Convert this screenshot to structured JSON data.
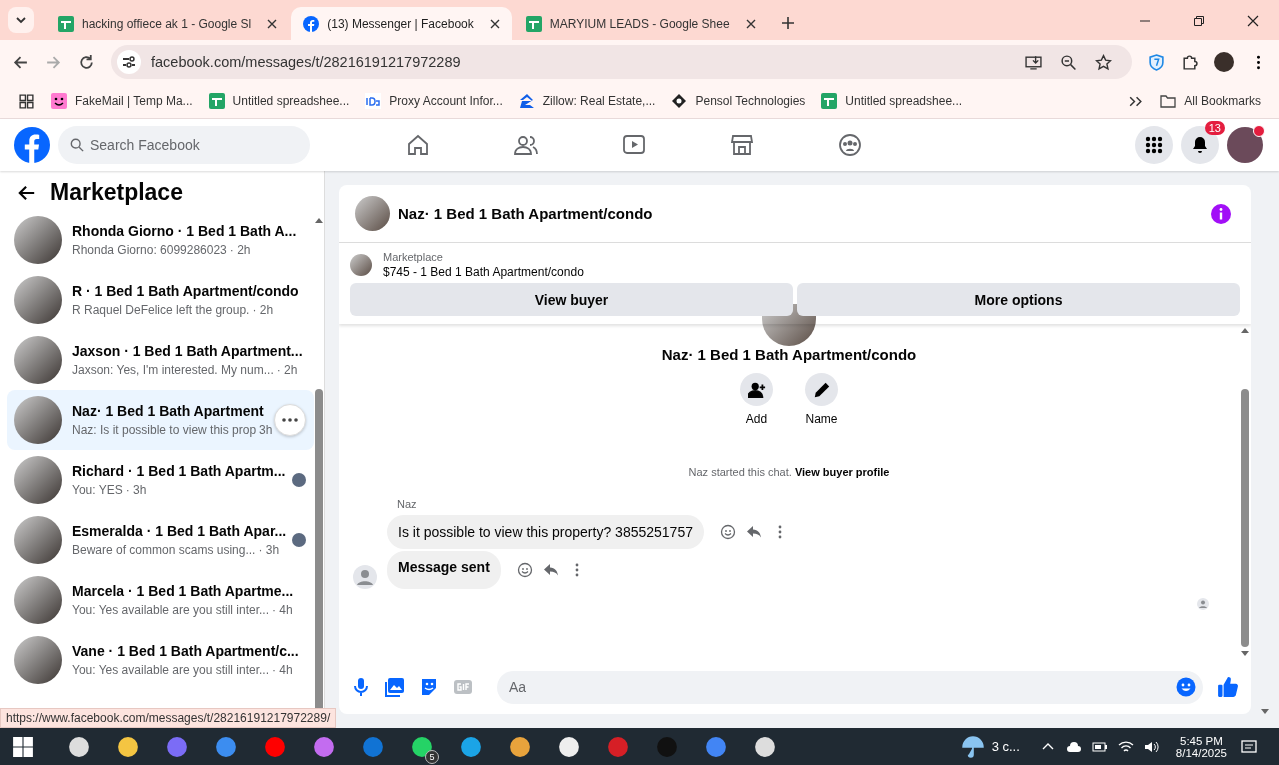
{
  "browser": {
    "tabs": [
      {
        "title": "hacking offiece ak 1 - Google Sl",
        "kind": "sheets",
        "selected": false
      },
      {
        "title": "(13) Messenger | Facebook",
        "kind": "facebook",
        "selected": true
      },
      {
        "title": "MARYIUM LEADS - Google Shee",
        "kind": "sheets",
        "selected": false
      }
    ],
    "url": "facebook.com/messages/t/28216191217972289",
    "bookmarks": [
      {
        "label": "FakeMail | Temp Ma...",
        "kind": "smiley"
      },
      {
        "label": "Untitled spreadshee...",
        "kind": "sheets"
      },
      {
        "label": "Proxy Account Infor...",
        "kind": "ip"
      },
      {
        "label": "Zillow: Real Estate,...",
        "kind": "zillow"
      },
      {
        "label": "Pensol Technologies",
        "kind": "pensol"
      },
      {
        "label": "Untitled spreadshee...",
        "kind": "sheets"
      }
    ],
    "all_bookmarks": "All Bookmarks"
  },
  "facebook": {
    "search": {
      "placeholder": "Search Facebook"
    },
    "notification_count": "13"
  },
  "sidebar": {
    "title": "Marketplace",
    "conversations": [
      {
        "title": "Rhonda Giorno · 1 Bed 1 Bath A...",
        "preview": "Rhonda Giorno: 6099286023",
        "time": "· 2h",
        "selected": false,
        "seen": false
      },
      {
        "title": "R · 1 Bed 1 Bath Apartment/condo",
        "preview": "R Raquel DeFelice left the group.",
        "time": "· 2h",
        "selected": false,
        "seen": false
      },
      {
        "title": "Jaxson · 1 Bed 1 Bath Apartment...",
        "preview": "Jaxson: Yes, I'm interested. My num...",
        "time": "· 2h",
        "selected": false,
        "seen": false
      },
      {
        "title": "Naz· 1 Bed 1 Bath Apartment",
        "preview": "Naz: Is it possible to view this prop",
        "time": "3h",
        "selected": true,
        "seen": false
      },
      {
        "title": "Richard · 1 Bed 1 Bath Apartm...",
        "preview": "You: YES",
        "time": "· 3h",
        "selected": false,
        "seen": true
      },
      {
        "title": "Esmeralda · 1 Bed 1 Bath Apar...",
        "preview": "Beware of common scams using...",
        "time": "· 3h",
        "selected": false,
        "seen": true
      },
      {
        "title": "Marcela · 1 Bed 1 Bath Apartme...",
        "preview": "You: Yes available are you still inter...",
        "time": "· 4h",
        "selected": false,
        "seen": false
      },
      {
        "title": "Vane · 1 Bed 1 Bath Apartment/c...",
        "preview": "You: Yes available are you still inter...",
        "time": "· 4h",
        "selected": false,
        "seen": false
      }
    ]
  },
  "chat": {
    "title": "Naz· 1 Bed 1 Bath Apartment/condo",
    "listing": {
      "label": "Marketplace",
      "text": "$745 - 1 Bed 1 Bath Apartment/condo"
    },
    "buttons": [
      "View buyer",
      "More options"
    ],
    "profile_name": "Naz· 1 Bed 1 Bath Apartment/condo",
    "actions": [
      {
        "label": "Add",
        "kind": "add-person"
      },
      {
        "label": "Name",
        "kind": "pencil"
      }
    ],
    "notice": "Naz started this chat.",
    "notice_link": "View buyer profile",
    "sender": "Naz",
    "messages": [
      {
        "text": "Is it possible to view this property? 3855251757",
        "kind": "normal"
      },
      {
        "text": "Message sent",
        "kind": "bold"
      }
    ],
    "composer": {
      "placeholder": "Aa"
    }
  },
  "status_url": "https://www.facebook.com/messages/t/28216191217972289/",
  "taskbar": {
    "whatsapp_badge": "5",
    "weather": "3 c...",
    "time": "5:45 PM",
    "date": "8/14/2025"
  }
}
